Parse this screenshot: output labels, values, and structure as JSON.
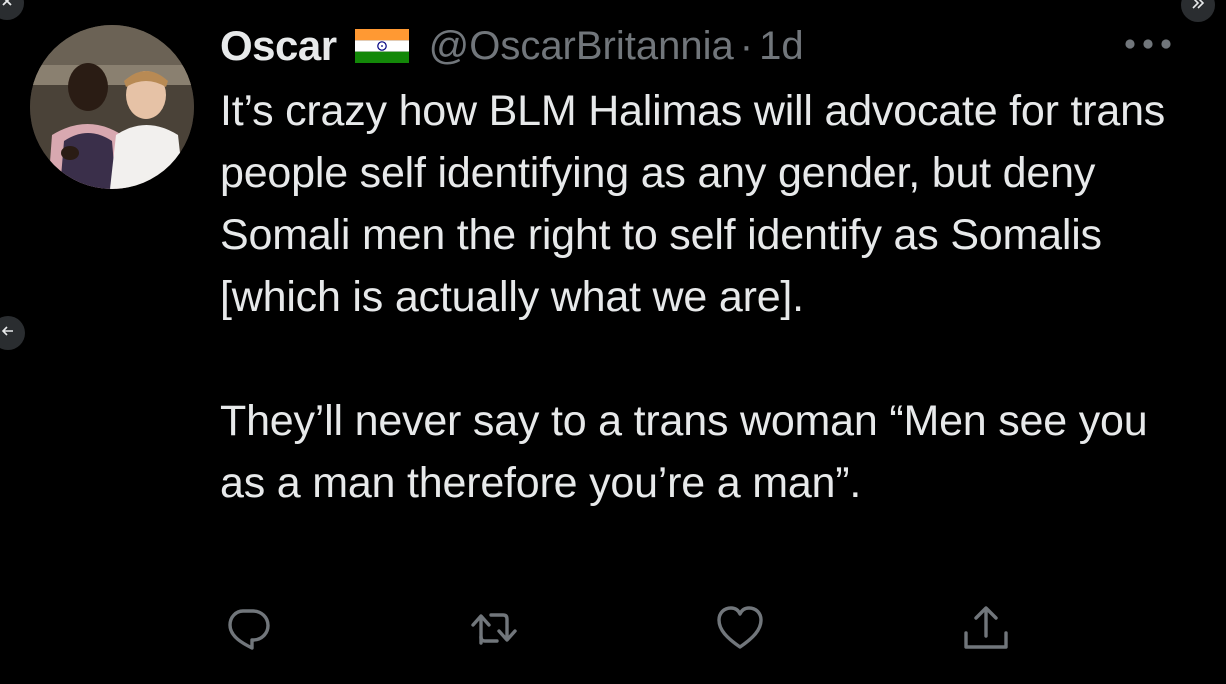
{
  "tweet": {
    "display_name": "Oscar",
    "flag": "india-flag-icon",
    "handle": "@OscarBritannia",
    "separator": "·",
    "time": "1d",
    "text": [
      "It’s crazy how BLM Halimas will advocate for trans people self identifying as any gender, but deny Somali men the right to self identify as Somalis [which is actually what we are].",
      "They’ll never say to a trans woman “Men see you as a man therefore you’re a man”."
    ]
  },
  "icons": {
    "close": "close-icon",
    "expand": "chevrons-right-icon",
    "back": "arrow-left-icon",
    "more": "more-icon",
    "reply": "reply-icon",
    "retweet": "retweet-icon",
    "like": "heart-icon",
    "share": "share-icon"
  },
  "colors": {
    "background": "#000000",
    "text": "#e7e9ea",
    "muted": "#71767b"
  }
}
